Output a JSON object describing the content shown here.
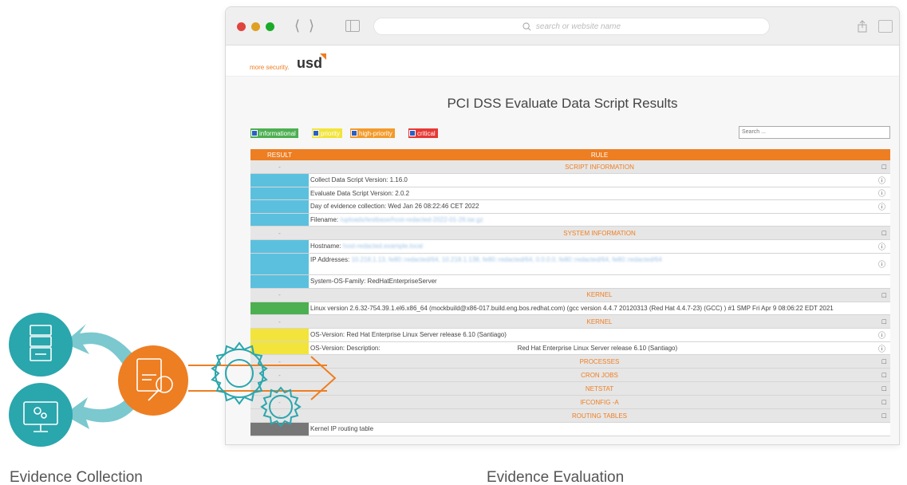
{
  "browser": {
    "url_placeholder": "search or website name",
    "traffic_lights": [
      "#e0443e",
      "#dea123",
      "#1aab29"
    ]
  },
  "brand": {
    "tagline": "more security.",
    "name": "usd"
  },
  "page_title": "PCI DSS Evaluate Data Script Results",
  "filters": [
    {
      "label": "informational",
      "color": "#4caf50"
    },
    {
      "label": "priority",
      "color": "#f2e43a"
    },
    {
      "label": "high-priority",
      "color": "#f39a2b"
    },
    {
      "label": "critical",
      "color": "#e53935"
    }
  ],
  "search_placeholder": "Search ...",
  "table": {
    "col_result": "RESULT",
    "col_rule": "RULE",
    "rows": [
      {
        "kind": "section",
        "label": "SCRIPT INFORMATION",
        "result": "-",
        "icon": "chat-icon"
      },
      {
        "kind": "item",
        "color": "#5bc0de",
        "text": "Collect Data Script Version: 1.16.0",
        "icon": "info-icon"
      },
      {
        "kind": "item",
        "color": "#5bc0de",
        "text": "Evaluate Data Script Version: 2.0.2",
        "icon": "info-icon"
      },
      {
        "kind": "item",
        "color": "#5bc0de",
        "text": "Day of evidence collection: Wed Jan 26 08:22:46 CET 2022",
        "icon": "info-icon"
      },
      {
        "kind": "item",
        "color": "#5bc0de",
        "text": "Filename:",
        "blurred": "/uploads/testbase/host-redacted-2022-01-26.tar.gz",
        "icon": ""
      },
      {
        "kind": "section",
        "label": "SYSTEM INFORMATION",
        "result": "-",
        "icon": "chat-icon"
      },
      {
        "kind": "item",
        "color": "#5bc0de",
        "text": "Hostname:",
        "blurred": "host-redacted.example.local",
        "icon": "info-icon"
      },
      {
        "kind": "item",
        "color": "#5bc0de",
        "text": "IP Addresses:",
        "blurred": "10.218.1.13, fe80::redacted/64, 10.218.1.138, fe80::redacted/64, 0.0.0.0, fe80::redacted/64, fe80::redacted/64",
        "icon": "info-icon",
        "tall": true
      },
      {
        "kind": "item",
        "color": "#5bc0de",
        "text": "System-OS-Family: RedHatEnterpriseServer",
        "icon": ""
      },
      {
        "kind": "section",
        "label": "KERNEL",
        "result": "-",
        "icon": "chat-icon"
      },
      {
        "kind": "item",
        "color": "#4caf50",
        "text": "Linux version 2.6.32-754.39.1.el6.x86_64 (mockbuild@x86-017.build.eng.bos.redhat.com) (gcc version 4.4.7 20120313 (Red Hat 4.4.7-23) (GCC) ) #1 SMP Fri Apr 9 08:06:22 EDT 2021",
        "icon": ""
      },
      {
        "kind": "section",
        "label": "KERNEL",
        "result": "-",
        "icon": "chat-icon"
      },
      {
        "kind": "item",
        "color": "#f2e43a",
        "text": "OS-Version: Red Hat Enterprise Linux Server release 6.10 (Santiago)",
        "icon": "info-icon"
      },
      {
        "kind": "item",
        "color": "#f2e43a",
        "text": "OS-Version: Description:",
        "right": "Red Hat Enterprise Linux Server release 6.10 (Santiago)",
        "icon": "info-icon"
      },
      {
        "kind": "section",
        "label": "PROCESSES",
        "result": "-",
        "icon": "chat-icon"
      },
      {
        "kind": "section",
        "label": "CRON JOBS",
        "result": "-",
        "icon": "chat-icon"
      },
      {
        "kind": "section",
        "label": "NETSTAT",
        "result": "-",
        "icon": "chat-icon"
      },
      {
        "kind": "section",
        "label": "IFCONFIG -A",
        "result": "-",
        "icon": "chat-icon"
      },
      {
        "kind": "section",
        "label": "ROUTING TABLES",
        "result": "-",
        "icon": "chat-icon"
      },
      {
        "kind": "item",
        "color": "#777777",
        "text": "Kernel IP routing table",
        "icon": ""
      }
    ]
  },
  "captions": {
    "left": "Evidence Collection",
    "right": "Evidence Evaluation"
  }
}
